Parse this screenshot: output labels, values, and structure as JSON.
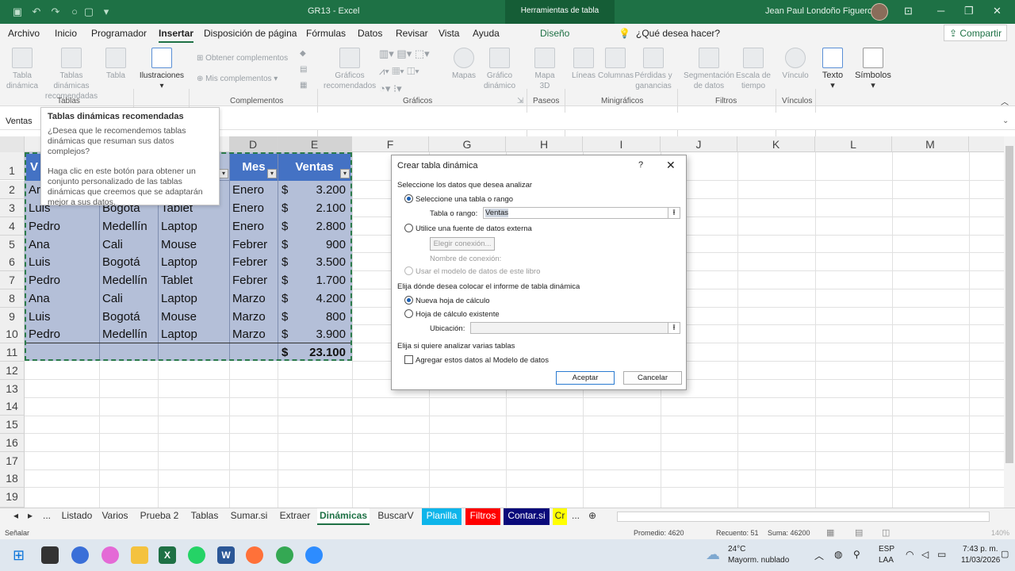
{
  "titlebar": {
    "document": "GR13",
    "app": "Excel",
    "separator": "-",
    "contextual_tab": "Herramientas de tabla",
    "user": "Jean Paul Londoño Figueroa"
  },
  "menu": {
    "items": [
      "Archivo",
      "Inicio",
      "Programador",
      "Insertar",
      "Disposición de página",
      "Fórmulas",
      "Datos",
      "Revisar",
      "Vista",
      "Ayuda",
      "Diseño"
    ],
    "active": "Insertar",
    "search": "¿Qué desea hacer?",
    "share": "Compartir"
  },
  "ribbon": {
    "tablas": {
      "group": "Tablas",
      "pivot": "Tabla dinámica",
      "recommended": "Tablas dinámicas recomendadas",
      "table": "Tabla"
    },
    "ilustraciones": "Ilustraciones",
    "complementos": {
      "group": "Complementos",
      "get": "Obtener complementos",
      "mine": "Mis complementos"
    },
    "graficos": {
      "group": "Gráficos",
      "recommended": "Gráficos recomendados",
      "maps": "Mapas",
      "pivotchart": "Gráfico dinámico"
    },
    "paseos": {
      "group": "Paseos",
      "map3d": "Mapa 3D"
    },
    "minigraficos": {
      "group": "Minigráficos",
      "lines": "Líneas",
      "columns": "Columnas",
      "winloss": "Pérdidas y ganancias"
    },
    "filtros": {
      "group": "Filtros",
      "slicer": "Segmentación de datos",
      "timeline": "Escala de tiempo"
    },
    "vinculos": {
      "group": "Vínculos",
      "link": "Vínculo"
    },
    "texto": "Texto",
    "simbolos": "Símbolos"
  },
  "tooltip": {
    "title": "Tablas dinámicas recomendadas",
    "p1": "¿Desea que le recomendemos tablas dinámicas que resuman sus datos complejos?",
    "p2": "Haga clic en este botón para obtener un conjunto personalizado de las tablas dinámicas que creemos que se adaptarán mejor a sus datos."
  },
  "namebox": "Ventas",
  "columns": [
    "D",
    "E",
    "F",
    "G",
    "H",
    "I",
    "J",
    "K",
    "L",
    "M"
  ],
  "rows": [
    "1",
    "2",
    "3",
    "4",
    "5",
    "6",
    "7",
    "8",
    "9",
    "10",
    "11",
    "12",
    "13",
    "14",
    "15",
    "16",
    "17",
    "18",
    "19"
  ],
  "table": {
    "headers": {
      "a": "V",
      "d": "Mes",
      "e": "Ventas"
    },
    "currency": "$",
    "rows": [
      {
        "a": "Ar",
        "b": "",
        "c": "",
        "d": "Enero",
        "e": "3.200"
      },
      {
        "a": "Luis",
        "b": "Bogota",
        "c": "Tablet",
        "d": "Enero",
        "e": "2.100"
      },
      {
        "a": "Pedro",
        "b": "Medellín",
        "c": "Laptop",
        "d": "Enero",
        "e": "2.800"
      },
      {
        "a": "Ana",
        "b": "Cali",
        "c": "Mouse",
        "d": "Febrer",
        "e": "900"
      },
      {
        "a": "Luis",
        "b": "Bogotá",
        "c": "Laptop",
        "d": "Febrer",
        "e": "3.500"
      },
      {
        "a": "Pedro",
        "b": "Medellín",
        "c": "Tablet",
        "d": "Febrer",
        "e": "1.700"
      },
      {
        "a": "Ana",
        "b": "Cali",
        "c": "Laptop",
        "d": "Marzo",
        "e": "4.200"
      },
      {
        "a": "Luis",
        "b": "Bogotá",
        "c": "Mouse",
        "d": "Marzo",
        "e": "800"
      },
      {
        "a": "Pedro",
        "b": "Medellín",
        "c": "Laptop",
        "d": "Marzo",
        "e": "3.900"
      }
    ],
    "total": "23.100"
  },
  "dialog": {
    "title": "Crear tabla dinámica",
    "help": "?",
    "close": "✕",
    "section1": "Seleccione los datos que desea analizar",
    "opt_table": "Seleccione una tabla o rango",
    "range_label": "Tabla o rango:",
    "range_value": "Ventas",
    "opt_external": "Utilice una fuente de datos externa",
    "choose_conn": "Elegir conexión...",
    "conn_name": "Nombre de conexión:",
    "opt_model": "Usar el modelo de datos de este libro",
    "section2": "Elija dónde desea colocar el informe de tabla dinámica",
    "opt_new": "Nueva hoja de cálculo",
    "opt_existing": "Hoja de cálculo existente",
    "location_label": "Ubicación:",
    "section3": "Elija si quiere analizar varias tablas",
    "add_model": "Agregar estos datos al Modelo de datos",
    "ok": "Aceptar",
    "cancel": "Cancelar"
  },
  "sheets": [
    {
      "name": "...",
      "bg": ""
    },
    {
      "name": "Listado",
      "bg": ""
    },
    {
      "name": "Varios",
      "bg": ""
    },
    {
      "name": "Prueba 2",
      "bg": ""
    },
    {
      "name": "Tablas",
      "bg": ""
    },
    {
      "name": "Sumar.si",
      "bg": ""
    },
    {
      "name": "Extraer",
      "bg": ""
    },
    {
      "name": "Dinámicas",
      "bg": "active"
    },
    {
      "name": "BuscarV",
      "bg": ""
    },
    {
      "name": "Planilla",
      "bg": "#0eb5ea"
    },
    {
      "name": "Filtros",
      "bg": "#ff0000"
    },
    {
      "name": "Contar.si",
      "bg": "#0a0a7a"
    },
    {
      "name": "Cr",
      "bg": "#ffff00"
    },
    {
      "name": "...",
      "bg": ""
    }
  ],
  "status": {
    "mode": "Señalar",
    "average": "Promedio: 4620",
    "count": "Recuento: 51",
    "sum": "Suma: 46200",
    "zoom": "140%"
  },
  "taskbar": {
    "temp": "24°C",
    "weather": "Mayorm. nublado",
    "lang1": "ESP",
    "lang2": "LAA",
    "time": "7:43 p. m.",
    "date": "11/03/2026"
  }
}
